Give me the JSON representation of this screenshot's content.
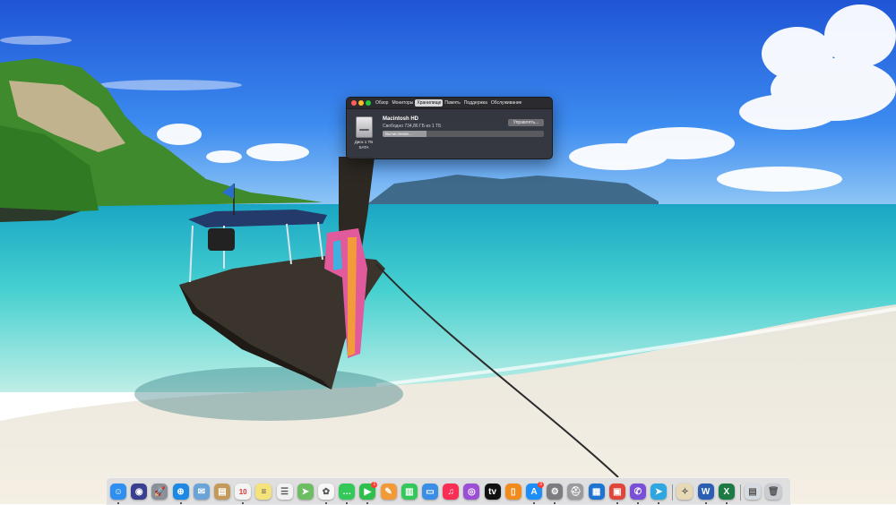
{
  "window": {
    "tabs": [
      {
        "label": "Обзор"
      },
      {
        "label": "Мониторы"
      },
      {
        "label": "Хранилище"
      },
      {
        "label": "Память"
      },
      {
        "label": "Поддержка"
      },
      {
        "label": "Обслуживание"
      }
    ],
    "active_tab_index": 2,
    "disk_name": "Macintosh HD",
    "disk_free": "Свободно 734,86 ГБ из 1 ТБ",
    "disk_capacity": "Диск 1 ТБ",
    "disk_type": "SATA",
    "manage_label": "Управлять...",
    "storage_status": "Вычисление...",
    "storage_progress": 0.27
  },
  "dock": {
    "apps": [
      {
        "icon": "finder-icon",
        "color": "#2f8ff0",
        "glyph": "☺"
      },
      {
        "icon": "siri-icon",
        "color": "#3b3f8f",
        "glyph": "◉"
      },
      {
        "icon": "launchpad-icon",
        "color": "#8a8f98",
        "glyph": "🚀"
      },
      {
        "icon": "safari-icon",
        "color": "#1e88e5",
        "glyph": "⊕"
      },
      {
        "icon": "mail-icon",
        "color": "#6aa3d8",
        "glyph": "✉"
      },
      {
        "icon": "contacts-icon",
        "color": "#c49a5a",
        "glyph": "▤"
      },
      {
        "icon": "calendar-icon",
        "color": "#f4f4f4",
        "glyph": "",
        "text": "10"
      },
      {
        "icon": "notes-icon",
        "color": "#f5e27a",
        "glyph": "≡"
      },
      {
        "icon": "reminders-icon",
        "color": "#f2f2f2",
        "glyph": "☰"
      },
      {
        "icon": "maps-icon",
        "color": "#6dbd63",
        "glyph": "➤"
      },
      {
        "icon": "photos-icon",
        "color": "#f7f7f7",
        "glyph": "✿"
      },
      {
        "icon": "messages-icon",
        "color": "#34c759",
        "glyph": "…"
      },
      {
        "icon": "facetime-icon",
        "color": "#2fbf4d",
        "glyph": "▶",
        "badge": "1"
      },
      {
        "icon": "pages-icon",
        "color": "#f29a38",
        "glyph": "✎"
      },
      {
        "icon": "numbers-icon",
        "color": "#34c759",
        "glyph": "▥"
      },
      {
        "icon": "keynote-icon",
        "color": "#3a8ee6",
        "glyph": "▭"
      },
      {
        "icon": "music-icon",
        "color": "#fa2d55",
        "glyph": "♫"
      },
      {
        "icon": "podcasts-icon",
        "color": "#9b4fd6",
        "glyph": "◎"
      },
      {
        "icon": "appletv-icon",
        "color": "#111111",
        "glyph": "tv"
      },
      {
        "icon": "books-icon",
        "color": "#f28b1e",
        "glyph": "▯"
      },
      {
        "icon": "appstore-icon",
        "color": "#1c8ef9",
        "glyph": "A",
        "badge": "3"
      },
      {
        "icon": "system-preferences-icon",
        "color": "#7b7b80",
        "glyph": "⚙"
      },
      {
        "icon": "disk-utility-icon",
        "color": "#9a9a9f",
        "glyph": "⛑"
      },
      {
        "icon": "trello-icon",
        "color": "#1f74d2",
        "glyph": "▦"
      },
      {
        "icon": "screen-sharing-icon",
        "color": "#e0463a",
        "glyph": "▣"
      },
      {
        "icon": "viber-icon",
        "color": "#7a4fd8",
        "glyph": "✆"
      },
      {
        "icon": "telegram-icon",
        "color": "#2ea7e0",
        "glyph": "➤"
      },
      {
        "icon": "preview-icon",
        "color": "#e8d9b6",
        "glyph": "✧"
      },
      {
        "icon": "word-icon",
        "color": "#2b5fb4",
        "glyph": "W"
      },
      {
        "icon": "excel-icon",
        "color": "#1e7a44",
        "glyph": "X"
      },
      {
        "icon": "downloads-folder-icon",
        "color": "#d6dbe2",
        "glyph": "▤"
      },
      {
        "icon": "trash-icon",
        "color": "#c9ccd1",
        "glyph": "🗑"
      }
    ],
    "running": [
      "finder-icon",
      "safari-icon",
      "calendar-icon",
      "photos-icon",
      "messages-icon",
      "facetime-icon",
      "appstore-icon",
      "system-preferences-icon",
      "screen-sharing-icon",
      "viber-icon",
      "telegram-icon",
      "word-icon",
      "excel-icon"
    ]
  }
}
